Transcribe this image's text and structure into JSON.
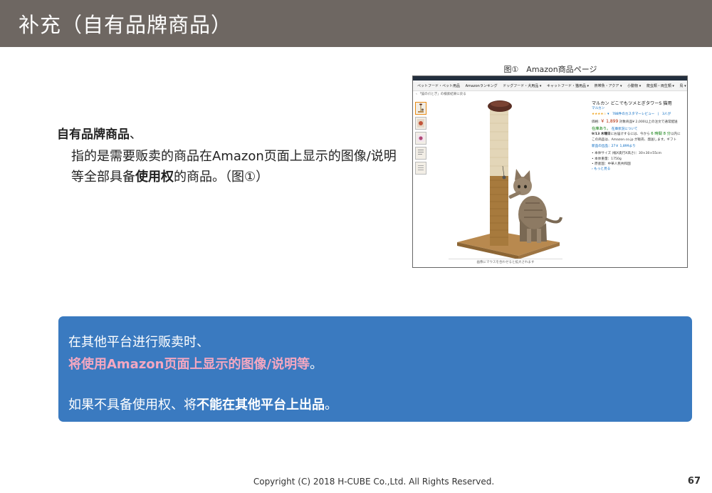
{
  "header": {
    "title": "补充（自有品牌商品）"
  },
  "intro": {
    "heading_bold": "自有品牌商品",
    "heading_tail": "、",
    "body_pre": "指的是需要贩卖的商品在Amazon页面上显示的图像/说明等全部具备",
    "body_bold": "使用权",
    "body_post": "的商品。（图①）"
  },
  "figure": {
    "caption": "图①　Amazon商品ページ",
    "nav_items": [
      "ペットフード・ペット用品",
      "Amazonランキング",
      "ドッグフード・犬用品 ▾",
      "キャットフード・猫用品 ▾",
      "熱帯魚・アクア ▾",
      "小動物 ▾",
      "爬虫類・両生類 ▾",
      "鳥 ▾",
      "還元"
    ],
    "breadcrumb": "‹ 「猫の爪とぎ」の検索結果に戻る",
    "image_note": "画像にマウスを合わせると拡大されます",
    "product": {
      "title": "マルカン どこでもツメとぎタワーS 猫用",
      "brand": "マルカン",
      "stars": "★★★★☆",
      "reviews": "▾　788件のカスタマーレビュー　|　3人が",
      "price_label": "価格:",
      "price": "￥ 1,899",
      "price_note": "対象商品¥ 2,000以上の注文で通常配送",
      "stock": "在庫あり。",
      "stock_link": "在庫状況について",
      "delivery_pre": "9/13 木曜日",
      "delivery_mid": "にお届けするには、今から",
      "delivery_time": "6 時間 8 分",
      "delivery_post": "以内に",
      "seller": "この商品は、Amazon.co.jp が販売、発送します。ギフト",
      "new_offers": "新品の出品：27￥ 1,899より",
      "bullets": [
        "本体サイズ (幅X奥行X高さ)：30×30×55cm",
        "本体重量：1750g",
        "原産国：中華人民共和国"
      ],
      "more": "› もっと見る"
    }
  },
  "bluebox": {
    "line1": "在其他平台进行贩卖时、",
    "line2_pink": "将使用Amazon页面上显示的图像/说明等",
    "line2_tail": "。",
    "line3_pre": "如果不具备使用权、将",
    "line3_bold": "不能在其他平台上出品",
    "line3_tail": "。"
  },
  "footer": {
    "copyright": "Copyright (C) 2018 H-CUBE Co.,Ltd. All Rights Reserved.",
    "page": "67"
  }
}
